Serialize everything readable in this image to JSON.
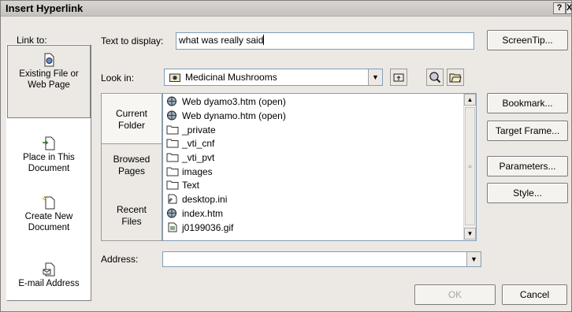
{
  "title": "Insert Hyperlink",
  "titlebar": {
    "help": "?",
    "close": "X"
  },
  "link_to": {
    "label": "Link to:",
    "items": [
      {
        "line1": "Existing File or",
        "line2": "Web Page",
        "selected": true,
        "icon": "document-web-icon"
      },
      {
        "line1": "Place in This",
        "line2": "Document",
        "selected": false,
        "icon": "document-place-icon"
      },
      {
        "line1": "Create New",
        "line2": "Document",
        "selected": false,
        "icon": "new-document-icon"
      },
      {
        "line1": "E-mail Address",
        "line2": "",
        "selected": false,
        "icon": "email-icon"
      }
    ]
  },
  "text_to_display": {
    "label": "Text to display:",
    "value": "what was really said"
  },
  "buttons": {
    "screentip": "ScreenTip...",
    "bookmark": "Bookmark...",
    "target_frame": "Target Frame...",
    "parameters": "Parameters...",
    "style": "Style...",
    "ok": "OK",
    "cancel": "Cancel"
  },
  "look_in": {
    "label": "Look in:",
    "value": "Medicinal Mushrooms"
  },
  "tabs": [
    {
      "line1": "Current",
      "line2": "Folder",
      "selected": true
    },
    {
      "line1": "Browsed",
      "line2": "Pages",
      "selected": false
    },
    {
      "line1": "Recent",
      "line2": "Files",
      "selected": false
    }
  ],
  "files": [
    {
      "name": "Web dyamo3.htm (open)",
      "icon": "html-file-icon"
    },
    {
      "name": "Web dynamo.htm (open)",
      "icon": "html-file-icon"
    },
    {
      "name": "_private",
      "icon": "folder-icon"
    },
    {
      "name": "_vti_cnf",
      "icon": "folder-icon"
    },
    {
      "name": "_vti_pvt",
      "icon": "folder-icon"
    },
    {
      "name": "images",
      "icon": "folder-icon"
    },
    {
      "name": "Text",
      "icon": "folder-icon"
    },
    {
      "name": "desktop.ini",
      "icon": "settings-file-icon"
    },
    {
      "name": "index.htm",
      "icon": "html-file-icon"
    },
    {
      "name": "j0199036.gif",
      "icon": "image-file-icon"
    }
  ],
  "address": {
    "label": "Address:",
    "value": ""
  }
}
